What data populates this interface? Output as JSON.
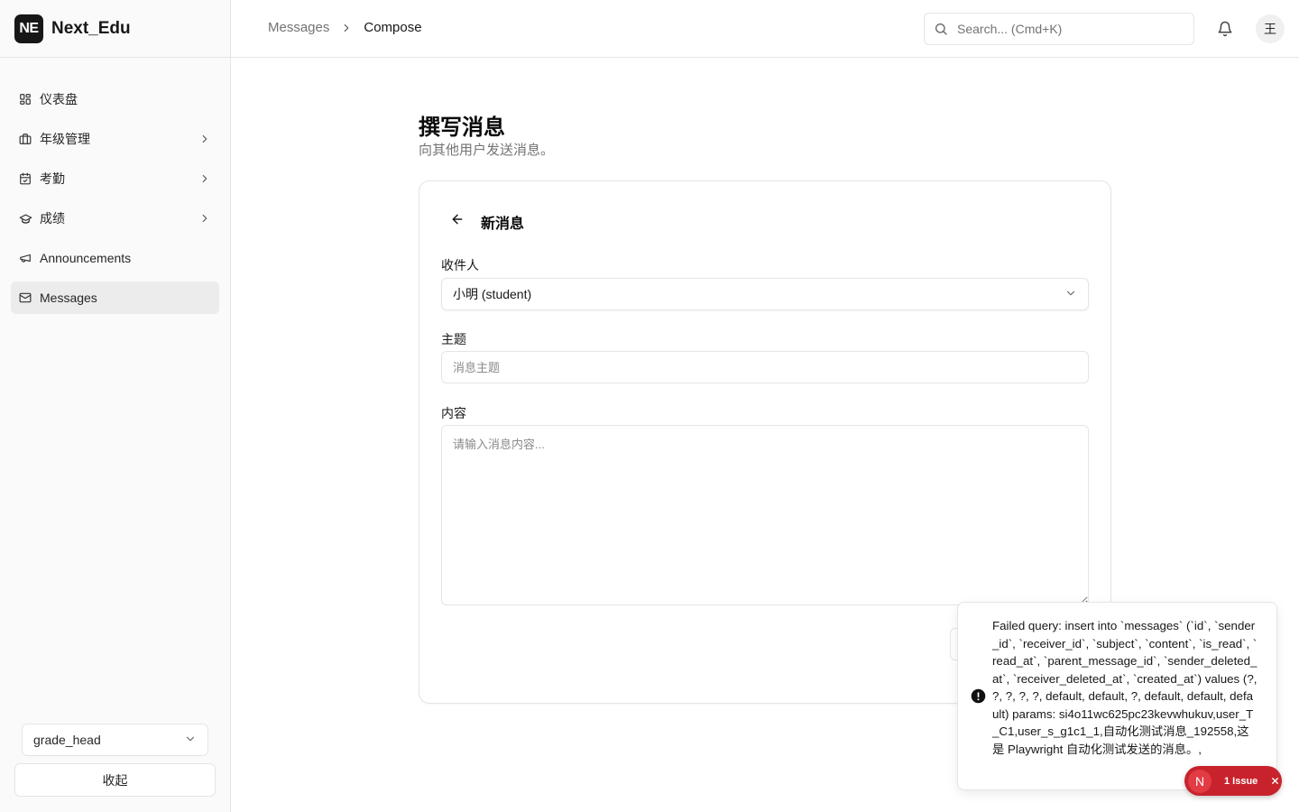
{
  "brand": {
    "logo_text": "NE",
    "name": "Next_Edu"
  },
  "sidebar": {
    "items": [
      {
        "label": "仪表盘",
        "icon": "dashboard-grid-icon",
        "has_chevron": false,
        "active": false
      },
      {
        "label": "年级管理",
        "icon": "briefcase-icon",
        "has_chevron": true,
        "active": false
      },
      {
        "label": "考勤",
        "icon": "calendar-check-icon",
        "has_chevron": true,
        "active": false
      },
      {
        "label": "成绩",
        "icon": "graduation-cap-icon",
        "has_chevron": true,
        "active": false
      },
      {
        "label": "Announcements",
        "icon": "megaphone-icon",
        "has_chevron": false,
        "active": false
      },
      {
        "label": "Messages",
        "icon": "mail-icon",
        "has_chevron": false,
        "active": true
      }
    ],
    "role_select": {
      "value": "grade_head"
    },
    "collapse_label": "收起"
  },
  "header": {
    "breadcrumb": [
      "Messages",
      "Compose"
    ],
    "search_placeholder": "Search... (Cmd+K)",
    "avatar_text": "王"
  },
  "page": {
    "title": "撰写消息",
    "subtitle": "向其他用户发送消息。"
  },
  "form": {
    "card_title": "新消息",
    "recipient_label": "收件人",
    "recipient_value": "小明 (student)",
    "subject_label": "主题",
    "subject_placeholder": "消息主题",
    "content_label": "内容",
    "content_placeholder": "请输入消息内容..."
  },
  "toast": {
    "message": "Failed query: insert into `messages` (`id`, `sender_id`, `receiver_id`, `subject`, `content`, `is_read`, `read_at`, `parent_message_id`, `sender_deleted_at`, `receiver_deleted_at`, `created_at`) values (?, ?, ?, ?, ?, default, default, ?, default, default, default) params: si4o11wc625pc23kevwhukuv,user_T_C1,user_s_g1c1_1,自动化测试消息_192558,这是 Playwright 自动化测试发送的消息。,"
  },
  "issue_badge": {
    "logo_text": "N",
    "label": "1 Issue"
  },
  "colors": {
    "primary": "#171717",
    "sidebar_bg": "#fafafa",
    "border": "#e5e5e5",
    "issue_red": "#c8232c"
  }
}
